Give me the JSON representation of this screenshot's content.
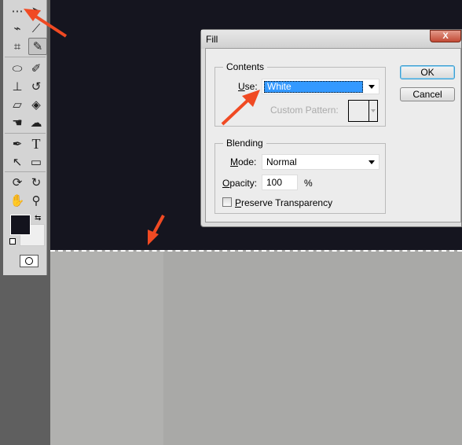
{
  "toolbar": {
    "tools": [
      "marquee-icon",
      "move-icon",
      "lasso-icon",
      "magic-wand-icon",
      "crop-icon",
      "eyedropper-icon",
      "healing-brush-icon",
      "brush-icon",
      "clone-stamp-icon",
      "history-brush-icon",
      "eraser-icon",
      "paint-bucket-icon",
      "dodge-icon",
      "smudge-icon",
      "pen-icon",
      "type-icon",
      "path-select-icon",
      "rectangle-icon",
      "rotate-view-icon",
      "3d-rotate-icon",
      "hand-icon",
      "zoom-icon"
    ],
    "foreground_color": "#13131d",
    "background_color": "#efefef"
  },
  "dialog": {
    "title": "Fill",
    "close": "X",
    "contents": {
      "legend": "Contents",
      "use_label_u": "U",
      "use_label_rest": "se:",
      "use_value": "White",
      "custom_pattern_label": "Custom Pattern:"
    },
    "blending": {
      "legend": "Blending",
      "mode_label_u": "M",
      "mode_label_rest": "ode:",
      "mode_value": "Normal",
      "opacity_label_u": "O",
      "opacity_label_rest": "pacity:",
      "opacity_value": "100",
      "opacity_unit": "%",
      "preserve_u": "P",
      "preserve_rest": "reserve Transparency",
      "preserve_checked": false
    },
    "ok": "OK",
    "cancel": "Cancel"
  },
  "colors": {
    "annotation_arrow": "#f04a23",
    "selection": "#3399ff"
  }
}
